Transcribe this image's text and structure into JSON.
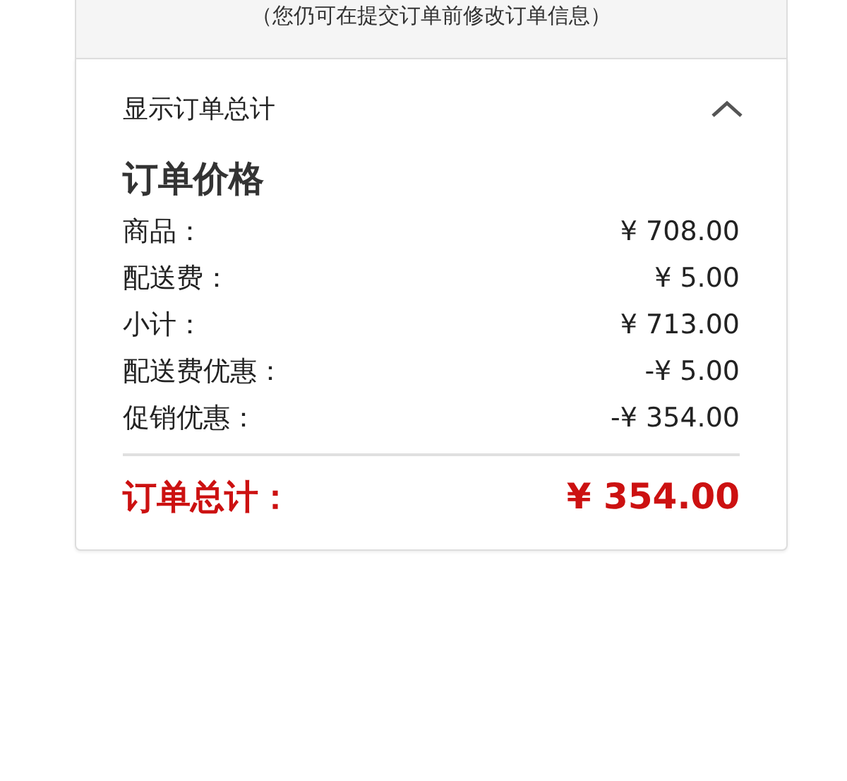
{
  "notice": "（您仍可在提交订单前修改订单信息）",
  "summary": {
    "title": "显示订单总计",
    "expanded": true,
    "heading": "订单价格",
    "rows": [
      {
        "label": "商品：",
        "value": "¥ 708.00"
      },
      {
        "label": "配送费：",
        "value": "¥ 5.00"
      },
      {
        "label": "小计：",
        "value": "¥ 713.00"
      },
      {
        "label": "配送费优惠：",
        "value": "-¥ 5.00"
      },
      {
        "label": "促销优惠：",
        "value": "-¥ 354.00"
      }
    ],
    "total": {
      "label": "订单总计：",
      "value": "¥ 354.00"
    }
  }
}
